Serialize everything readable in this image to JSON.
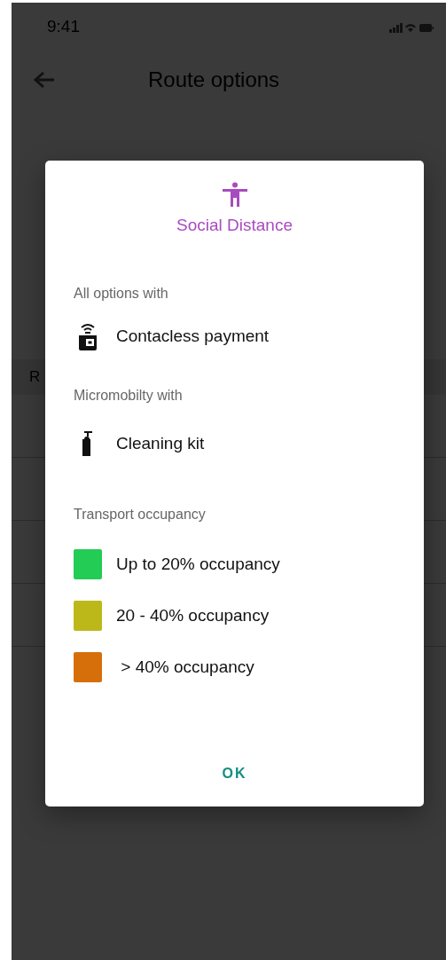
{
  "status_bar": {
    "time": "9:41"
  },
  "header": {
    "title": "Route options"
  },
  "background_list": {
    "section_label": "R"
  },
  "dialog": {
    "title": "Social Distance",
    "sections": [
      {
        "heading": "All options with",
        "items": [
          {
            "kind": "wallet",
            "label": "Contacless payment"
          }
        ]
      },
      {
        "heading": "Micromobilty with",
        "items": [
          {
            "kind": "bottle",
            "label": "Cleaning kit"
          }
        ]
      },
      {
        "heading": "Transport occupancy",
        "items": [
          {
            "kind": "swatch",
            "label": "Up to 20% occupancy",
            "color": "#22cc55"
          },
          {
            "kind": "swatch",
            "label": "20 - 40% occupancy",
            "color": "#bdb81a"
          },
          {
            "kind": "swatch",
            "label": " > 40% occupancy",
            "color": "#d66f0a"
          }
        ]
      }
    ],
    "button": "OK"
  }
}
